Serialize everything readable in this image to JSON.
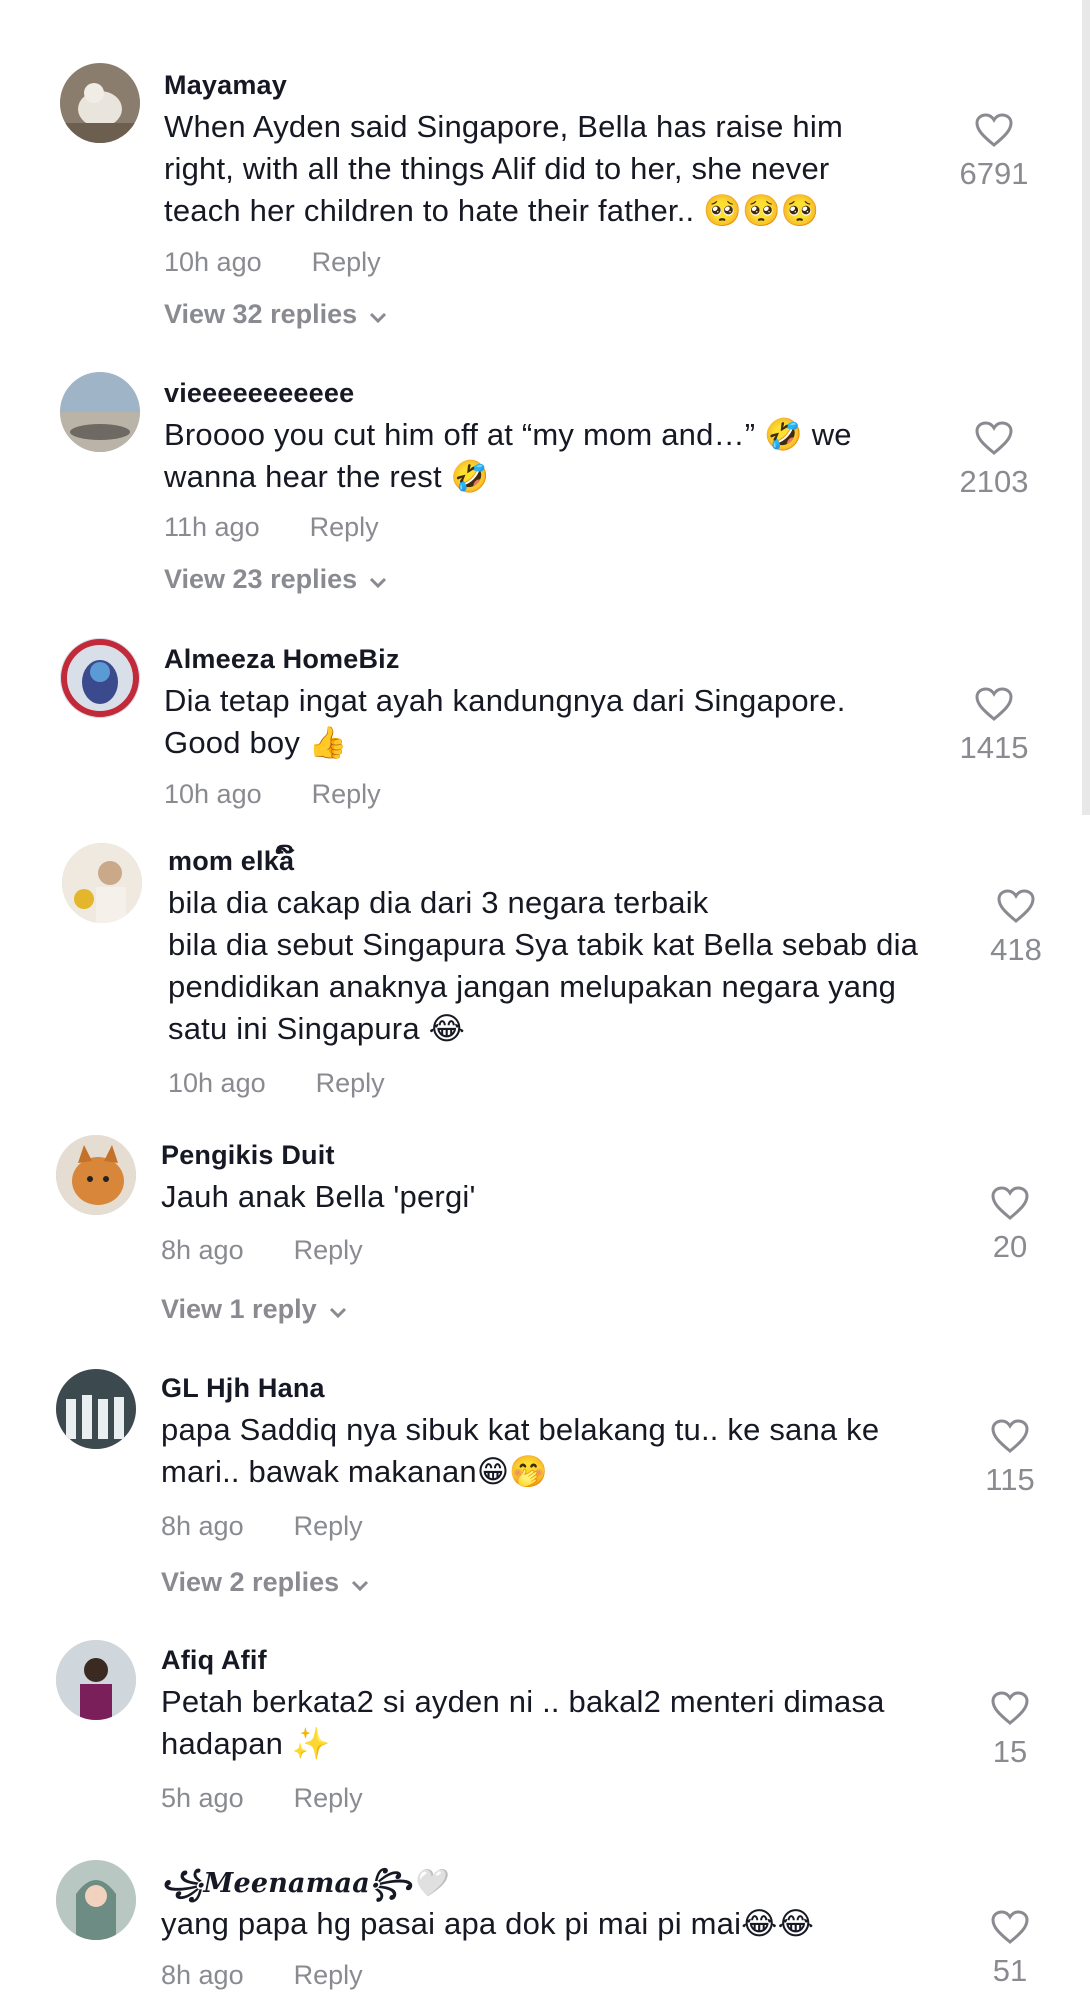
{
  "comments": [
    {
      "username": "Mayamay",
      "text": "When Ayden said Singapore, Bella has raise him right, with all the things Alif did to her, she never teach her children to hate their father.. 🥺🥺🥺",
      "time": "10h ago",
      "reply_label": "Reply",
      "likes": "6791",
      "view_replies": "View 32 replies"
    },
    {
      "username": "vieeeeeeeeeee",
      "text": "Broooo you cut him off at “my mom and…” 🤣 we wanna hear the rest 🤣",
      "time": "11h ago",
      "reply_label": "Reply",
      "likes": "2103",
      "view_replies": "View 23 replies"
    },
    {
      "username": "Almeeza HomeBiz",
      "text": "Dia tetap ingat ayah kandungnya dari Singapore. Good boy 👍",
      "time": "10h ago",
      "reply_label": "Reply",
      "likes": "1415"
    },
    {
      "username": "mom elka໌ິ",
      "text": "bila dia cakap dia dari 3 negara terbaik\nbila dia sebut Singapura Sya tabik kat Bella sebab dia pendidikan anaknya jangan melupakan negara yang satu ini Singapura 😂",
      "time": "10h ago",
      "reply_label": "Reply",
      "likes": "418"
    },
    {
      "username": "Pengikis Duit",
      "text": "Jauh anak Bella 'pergi'",
      "time": "8h ago",
      "reply_label": "Reply",
      "likes": "20",
      "view_replies": "View 1 reply"
    },
    {
      "username": "GL Hjh Hana",
      "text": "papa Saddiq nya sibuk kat belakang tu.. ke sana ke mari.. bawak makanan😁🤭",
      "time": "8h ago",
      "reply_label": "Reply",
      "likes": "115",
      "view_replies": "View 2 replies"
    },
    {
      "username": "Afiq Afif",
      "text": "Petah berkata2 si ayden ni .. bakal2 menteri dimasa hadapan ✨",
      "time": "5h ago",
      "reply_label": "Reply",
      "likes": "15"
    },
    {
      "username": "꧁𝑴𝒆𝒆𝒏𝒂𝒎𝒂𝒂꧂🤍",
      "text": "yang papa hg pasai apa dok pi mai pi mai😂😂",
      "time": "8h ago",
      "reply_label": "Reply",
      "likes": "51"
    }
  ],
  "icons": {
    "like": "heart-outline-icon",
    "expand": "chevron-down-icon"
  },
  "colors": {
    "text": "#161823",
    "muted": "#8a8b91"
  }
}
